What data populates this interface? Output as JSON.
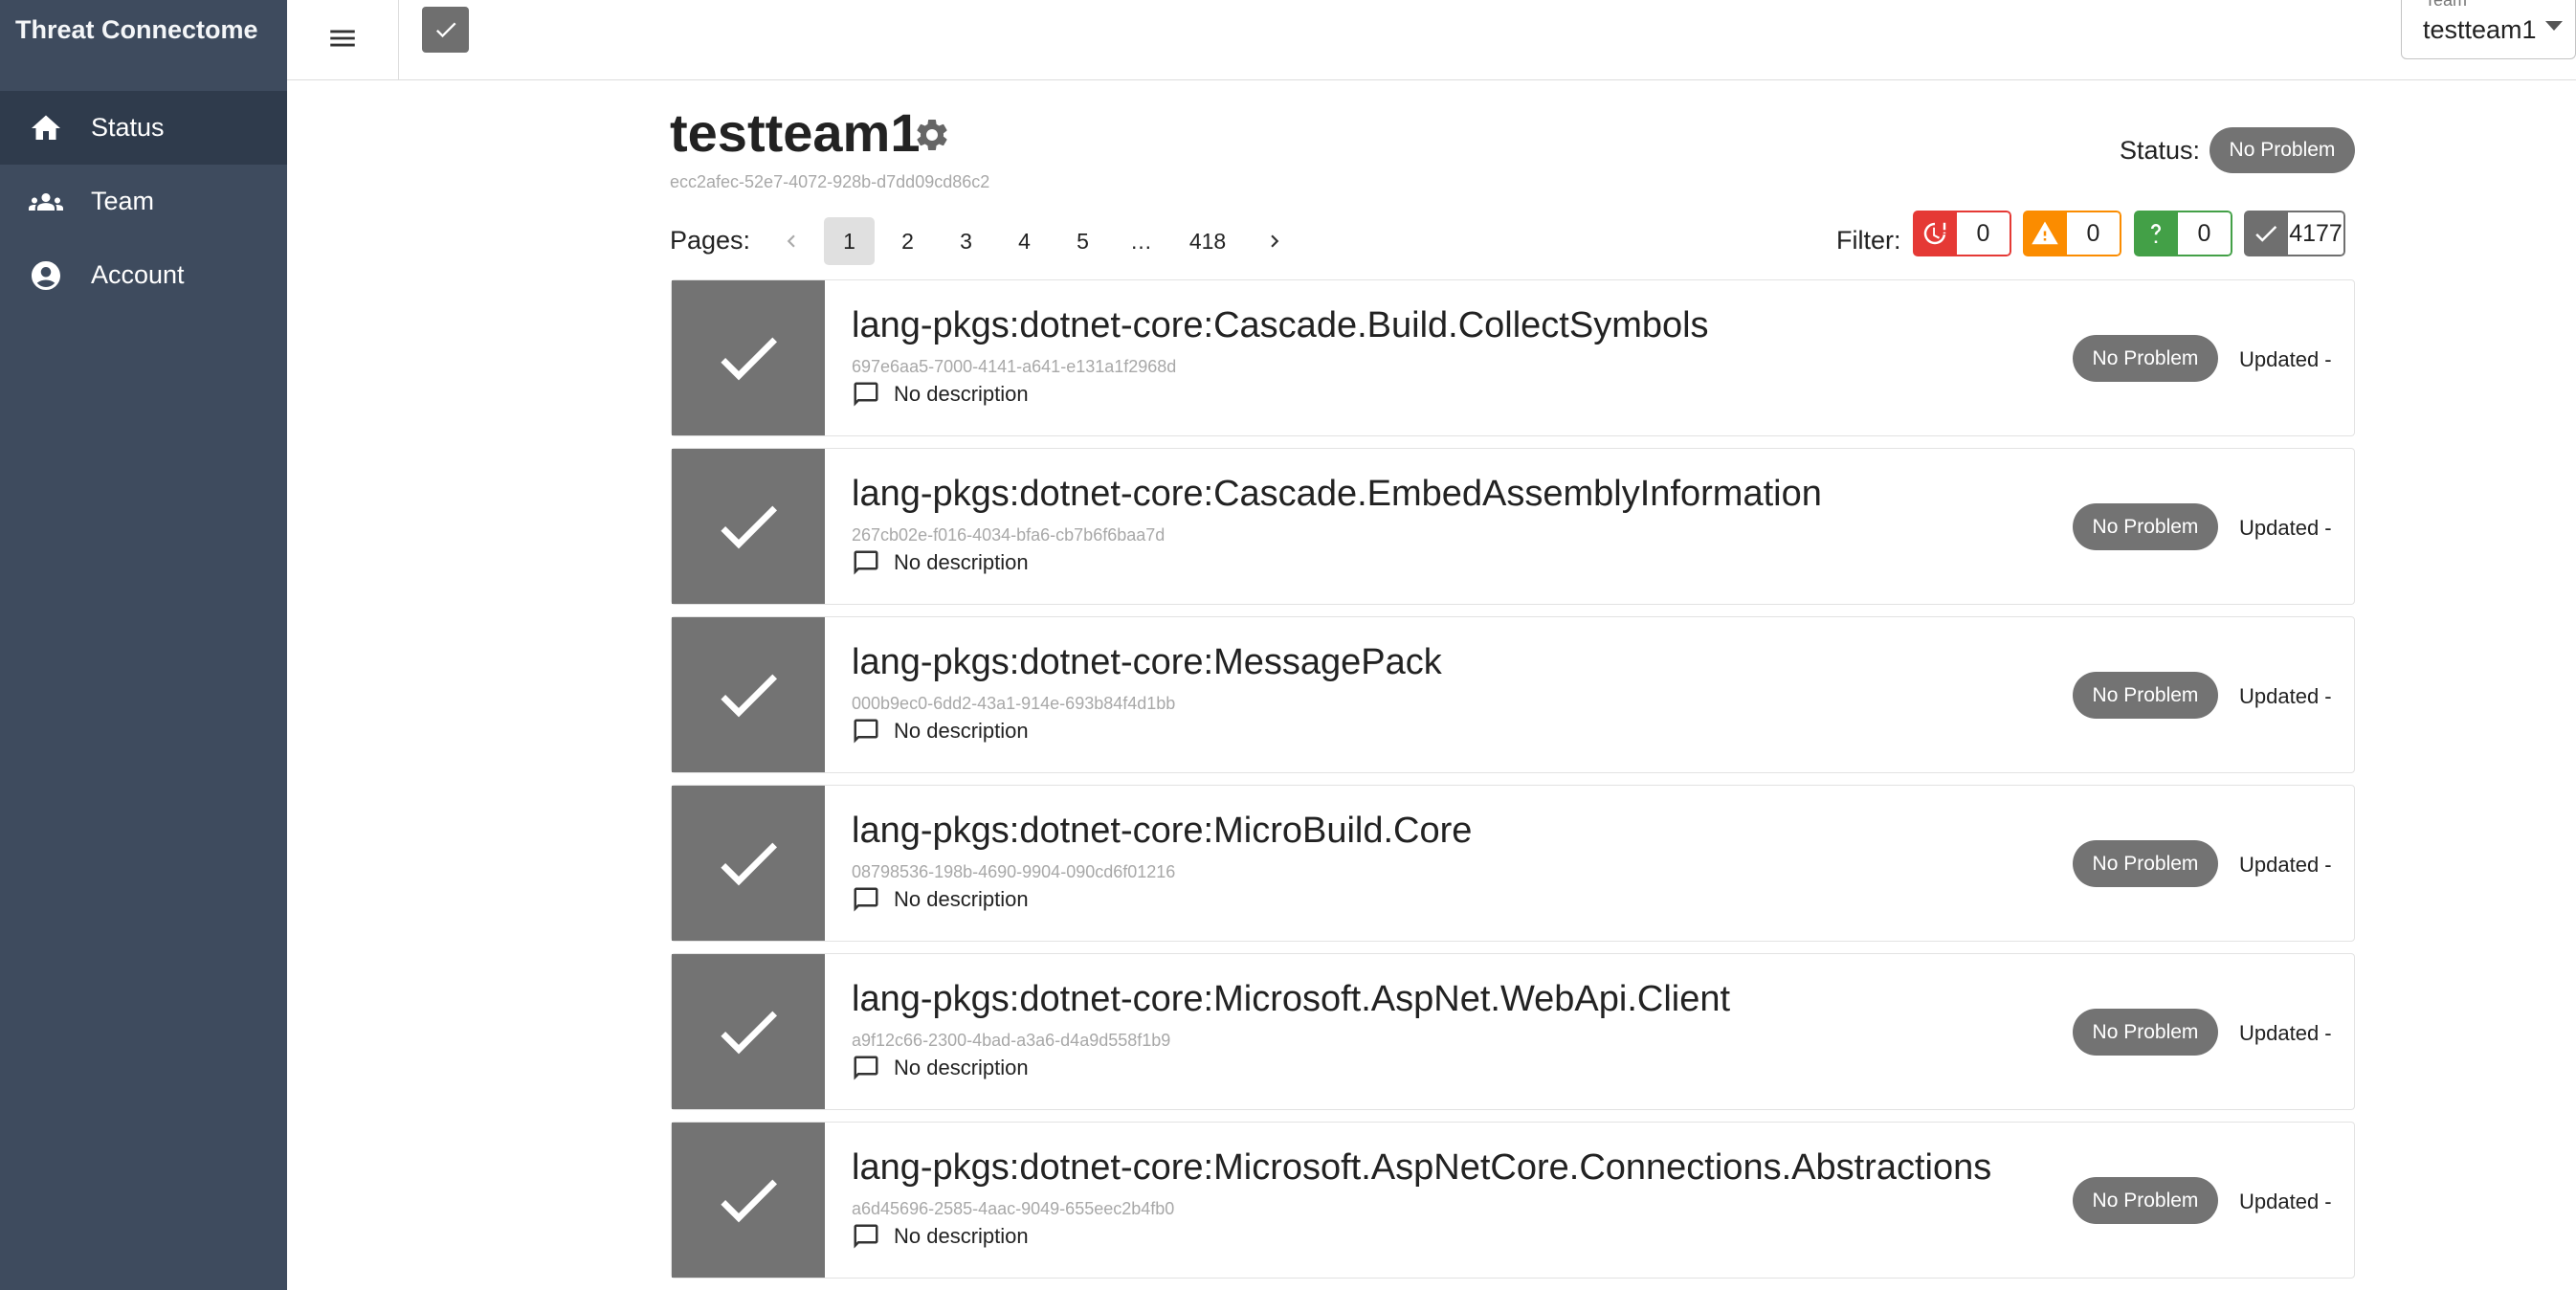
{
  "app": {
    "title": "Threat Connectome"
  },
  "sidebar": {
    "items": [
      {
        "label": "Status",
        "icon": "home-icon",
        "active": true
      },
      {
        "label": "Team",
        "icon": "groups-icon",
        "active": false
      },
      {
        "label": "Account",
        "icon": "account-circle-icon",
        "active": false
      }
    ]
  },
  "topbar": {
    "team_select": {
      "label": "Team",
      "value": "testteam1"
    }
  },
  "header": {
    "title": "testteam1",
    "team_id": "ecc2afec-52e7-4072-928b-d7dd09cd86c2",
    "status_label": "Status:",
    "status_value": "No Problem"
  },
  "pagination": {
    "label": "Pages:",
    "pages": [
      "1",
      "2",
      "3",
      "4",
      "5",
      "…",
      "418"
    ],
    "current": "1"
  },
  "filter": {
    "label": "Filter:",
    "immediate": "0",
    "warning": "0",
    "unknown": "0",
    "no_problem": "4177",
    "colors": {
      "immediate": "#e53935",
      "warning": "#fb8c00",
      "unknown": "#43a047",
      "no_problem": "#6f6f6f"
    }
  },
  "cards": [
    {
      "title": "lang-pkgs:dotnet-core:Cascade.Build.CollectSymbols",
      "id": "697e6aa5-7000-4141-a641-e131a1f2968d",
      "description": "No description",
      "status": "No Problem",
      "updated": "Updated -"
    },
    {
      "title": "lang-pkgs:dotnet-core:Cascade.EmbedAssemblyInformation",
      "id": "267cb02e-f016-4034-bfa6-cb7b6f6baa7d",
      "description": "No description",
      "status": "No Problem",
      "updated": "Updated -"
    },
    {
      "title": "lang-pkgs:dotnet-core:MessagePack",
      "id": "000b9ec0-6dd2-43a1-914e-693b84f4d1bb",
      "description": "No description",
      "status": "No Problem",
      "updated": "Updated -"
    },
    {
      "title": "lang-pkgs:dotnet-core:MicroBuild.Core",
      "id": "08798536-198b-4690-9904-090cd6f01216",
      "description": "No description",
      "status": "No Problem",
      "updated": "Updated -"
    },
    {
      "title": "lang-pkgs:dotnet-core:Microsoft.AspNet.WebApi.Client",
      "id": "a9f12c66-2300-4bad-a3a6-d4a9d558f1b9",
      "description": "No description",
      "status": "No Problem",
      "updated": "Updated -"
    },
    {
      "title": "lang-pkgs:dotnet-core:Microsoft.AspNetCore.Connections.Abstractions",
      "id": "a6d45696-2585-4aac-9049-655eec2b4fb0",
      "description": "No description",
      "status": "No Problem",
      "updated": "Updated -"
    }
  ]
}
